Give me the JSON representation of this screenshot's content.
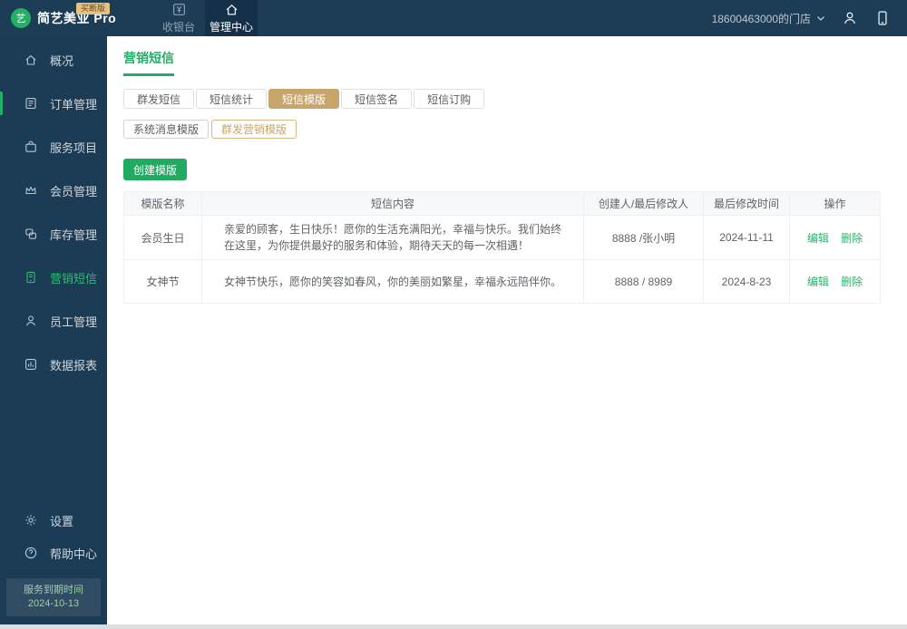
{
  "topbar": {
    "brand": {
      "name": "简艺美业 Pro",
      "badge": "买断版",
      "logo_glyph": "艺"
    },
    "tabs": [
      {
        "label": "收银台",
        "active": false
      },
      {
        "label": "管理中心",
        "active": true
      }
    ],
    "store": {
      "label": "18600463000的门店"
    }
  },
  "sidebar": {
    "items": [
      {
        "label": "概况"
      },
      {
        "label": "订单管理"
      },
      {
        "label": "服务项目"
      },
      {
        "label": "会员管理"
      },
      {
        "label": "库存管理"
      },
      {
        "label": "营销短信"
      },
      {
        "label": "员工管理"
      },
      {
        "label": "数据报表"
      }
    ],
    "bottom_items": [
      {
        "label": "设置"
      },
      {
        "label": "帮助中心"
      }
    ],
    "expiry": {
      "label": "服务到期时间",
      "date": "2024-10-13"
    }
  },
  "main": {
    "title": "营销短信",
    "tabs": [
      {
        "label": "群发短信"
      },
      {
        "label": "短信统计"
      },
      {
        "label": "短信模版"
      },
      {
        "label": "短信签名"
      },
      {
        "label": "短信订购"
      }
    ],
    "subtabs": [
      {
        "label": "系统消息模版"
      },
      {
        "label": "群发营销模版"
      }
    ],
    "create_button": "创建模版",
    "table": {
      "headers": [
        "模版名称",
        "短信内容",
        "创建人/最后修改人",
        "最后修改时间",
        "操作"
      ],
      "rows": [
        {
          "name": "会员生日",
          "content": "亲爱的顾客，生日快乐！愿你的生活充满阳光，幸福与快乐。我们始终在这里，为你提供最好的服务和体验，期待天天的每一次相遇！",
          "editor": "8888 /张小明",
          "time": "2024-11-11",
          "edit": "编辑",
          "delete": "删除"
        },
        {
          "name": "女神节",
          "content": "女神节快乐，愿你的笑容如春风，你的美丽如繁星，幸福永远陪伴你。",
          "editor": "8888 / 8989",
          "time": "2024-8-23",
          "edit": "编辑",
          "delete": "删除"
        }
      ]
    }
  },
  "colors": {
    "topbar_bg": "#1d3c56",
    "sidebar_bg": "#1c3b54",
    "accent_green": "#23ad66",
    "accent_tan": "#c8a56a",
    "link_green": "#30ae6e"
  }
}
